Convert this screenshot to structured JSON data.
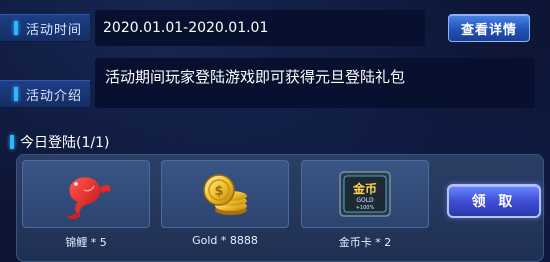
{
  "activity": {
    "time_label": "活动时间",
    "time_value": "2020.01.01-2020.01.01",
    "details_button": "查看详情",
    "intro_label": "活动介绍",
    "intro_text": "活动期间玩家登陆游戏即可获得元旦登陆礼包"
  },
  "login": {
    "today_label": "今日登陆(1/1)",
    "claim_button": "领 取",
    "rewards": [
      {
        "name": "锦鲤 * 5",
        "icon": "koi-fish-icon"
      },
      {
        "name": "Gold * 8888",
        "icon": "gold-coins-icon"
      },
      {
        "name": "金币卡 * 2",
        "icon": "gold-card-icon"
      }
    ],
    "card_icon_text": "金币",
    "card_icon_sub": "GOLD",
    "card_icon_value": "+100%"
  },
  "colors": {
    "background": "#0d1636",
    "accent": "#2fb6ff",
    "claim_button": "#3f4fd8"
  }
}
